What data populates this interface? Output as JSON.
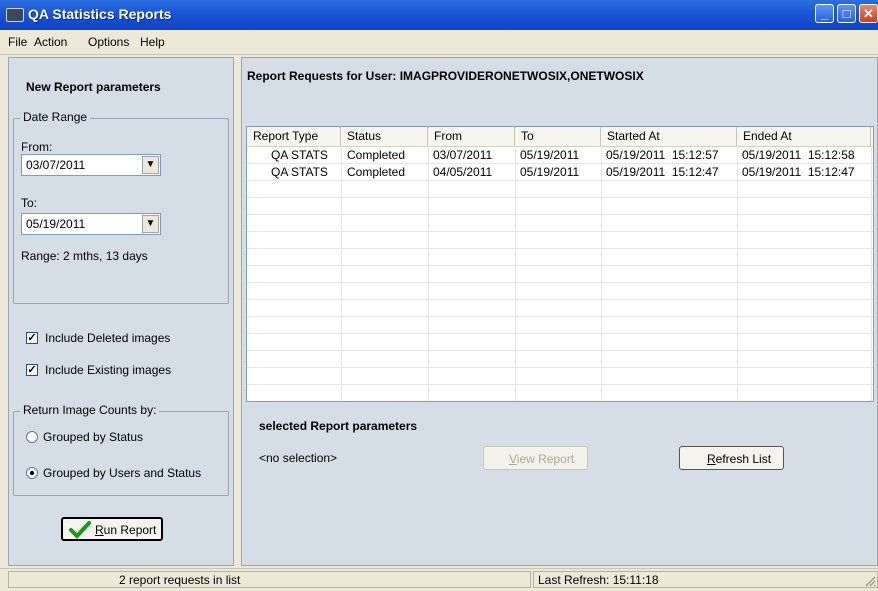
{
  "window": {
    "title": "QA Statistics Reports",
    "icon": "app-icon"
  },
  "menu": {
    "file": "File",
    "action": "Action",
    "options": "Options",
    "help": "Help"
  },
  "left": {
    "heading": "New Report parameters",
    "date_range_label": "Date Range",
    "from_label": "From:",
    "from_value": "03/07/2011",
    "to_label": "To:",
    "to_value": "05/19/2011",
    "range_text": "Range:  2 mths, 13 days",
    "include_deleted_label": "Include Deleted images",
    "include_deleted_checked": true,
    "include_existing_label": "Include Existing images",
    "include_existing_checked": true,
    "return_counts_label": "Return Image Counts by:",
    "grouped_status_label": "Grouped by Status",
    "grouped_users_label": "Grouped by Users and Status",
    "selected_grouping": "Grouped by Users and Status",
    "run_button_rest": "un Report",
    "run_button_mnemonic": "R"
  },
  "right": {
    "heading": "Report Requests for User: IMAGPROVIDERONETWOSIX,ONETWOSIX",
    "columns": [
      "Report Type",
      "Status",
      "From",
      "To",
      "Started At",
      "Ended At"
    ],
    "rows": [
      [
        "QA STATS",
        "Completed",
        "03/07/2011",
        "05/19/2011",
        "05/19/2011  15:12:57",
        "05/19/2011  15:12:58"
      ],
      [
        "QA STATS",
        "Completed",
        "04/05/2011",
        "05/19/2011",
        "05/19/2011  15:12:47",
        "05/19/2011  15:12:47"
      ]
    ],
    "selected_params_heading": "selected Report parameters",
    "no_selection": "<no selection>",
    "view_report_mnemonic": "V",
    "view_report_rest": "iew Report",
    "refresh_mnemonic": "R",
    "refresh_rest": "efresh List"
  },
  "status": {
    "left_text": "2 report requests in list",
    "right_text": "Last Refresh: 15:11:18"
  },
  "colors": {
    "title_bar": "#1a54d6",
    "panel": "#d5dde6",
    "check_green": "#1a9a1a"
  }
}
